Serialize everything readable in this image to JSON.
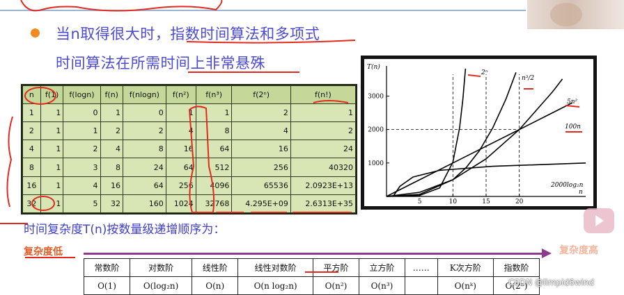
{
  "headline": {
    "line1": "当n取得很大时，指数时间算法和多项式",
    "line2": "时间算法在所需时间上非常悬殊"
  },
  "growth_table": {
    "headers": [
      "n",
      "f(1)",
      "f(logn)",
      "f(n)",
      "f(nlogn)",
      "f(n²)",
      "f(n³)",
      "f(2ⁿ)",
      "f(n!)"
    ],
    "rows": [
      [
        "1",
        "1",
        "0",
        "1",
        "0",
        "1",
        "1",
        "2",
        "1"
      ],
      [
        "2",
        "1",
        "1",
        "2",
        "2",
        "4",
        "8",
        "4",
        "2"
      ],
      [
        "4",
        "1",
        "2",
        "4",
        "8",
        "16",
        "64",
        "16",
        "24"
      ],
      [
        "8",
        "1",
        "3",
        "8",
        "24",
        "64",
        "512",
        "256",
        "40320"
      ],
      [
        "16",
        "1",
        "4",
        "16",
        "64",
        "256",
        "4096",
        "65536",
        "2.0923E+13"
      ],
      [
        "32",
        "1",
        "5",
        "32",
        "160",
        "1024",
        "32768",
        "4.295E+09",
        "2.6313E+35"
      ]
    ]
  },
  "chart_data": {
    "type": "line",
    "ylabel": "T(n)",
    "xlabel": "n",
    "xticks": [
      5,
      10,
      15,
      20
    ],
    "yticks": [
      1000,
      2000,
      3000
    ],
    "xlim": [
      0,
      30
    ],
    "ylim": [
      0,
      3900
    ],
    "series": [
      {
        "name": "2ⁿ",
        "points": [
          [
            0,
            1
          ],
          [
            5,
            32
          ],
          [
            8,
            256
          ],
          [
            10,
            1024
          ],
          [
            11,
            2048
          ],
          [
            11.5,
            2896
          ],
          [
            11.9,
            3822
          ]
        ]
      },
      {
        "name": "n³/2",
        "points": [
          [
            0,
            0
          ],
          [
            5,
            62.5
          ],
          [
            10,
            500
          ],
          [
            12,
            864
          ],
          [
            14,
            1372
          ],
          [
            16,
            2048
          ],
          [
            18,
            2916
          ],
          [
            19.5,
            3707
          ]
        ]
      },
      {
        "name": "5n²",
        "points": [
          [
            0,
            0
          ],
          [
            5,
            125
          ],
          [
            10,
            500
          ],
          [
            15,
            1125
          ],
          [
            20,
            2000
          ],
          [
            25,
            3125
          ],
          [
            26.5,
            3511
          ]
        ]
      },
      {
        "name": "100n",
        "points": [
          [
            0,
            0
          ],
          [
            5,
            500
          ],
          [
            10,
            1000
          ],
          [
            15,
            1500
          ],
          [
            20,
            2000
          ],
          [
            25,
            2500
          ],
          [
            28,
            2800
          ]
        ]
      },
      {
        "name": "2000log₂n",
        "points": [
          [
            1,
            0
          ],
          [
            2,
            300
          ],
          [
            4,
            580
          ],
          [
            8,
            780
          ],
          [
            16,
            900
          ],
          [
            30,
            1000
          ]
        ]
      }
    ],
    "reference_lines": [
      {
        "axis": "y",
        "value": 2000
      },
      {
        "axis": "x",
        "value": 10
      },
      {
        "axis": "x",
        "value": 15
      },
      {
        "axis": "x",
        "value": 20
      }
    ],
    "annotations": [
      "2ⁿ",
      "n³/2",
      "5n²",
      "100n",
      "2000log₂n"
    ]
  },
  "order": {
    "title": "时间复杂度T(n)按数量级递增顺序为：",
    "low_label": "复杂度低",
    "high_label": "复杂度高",
    "names": [
      "常数阶",
      "对数阶",
      "线性阶",
      "线性对数阶",
      "平方阶",
      "立方阶",
      "……",
      "K次方阶",
      "指数阶"
    ],
    "complexities": [
      "O(1)",
      "O(log₂n)",
      "O(n)",
      "O(n log₂n)",
      "O(n²)",
      "O(n³)",
      "",
      "O(nᵏ)",
      "O(2ⁿ)"
    ]
  },
  "watermark": "CSDN @limpid6wind",
  "colors": {
    "headline_text": "#4a4ad2",
    "bullet": "#f08a22",
    "table_cell": "#d8e6b5",
    "table_border": "#2f3a1f",
    "annotation_red": "#e02a1e",
    "arrow": "#8e3a8e",
    "low_high_label": "#e25a24"
  },
  "icons": {
    "bullet": "orange-dot",
    "watermark_logo": "bilibili-play-icon"
  }
}
